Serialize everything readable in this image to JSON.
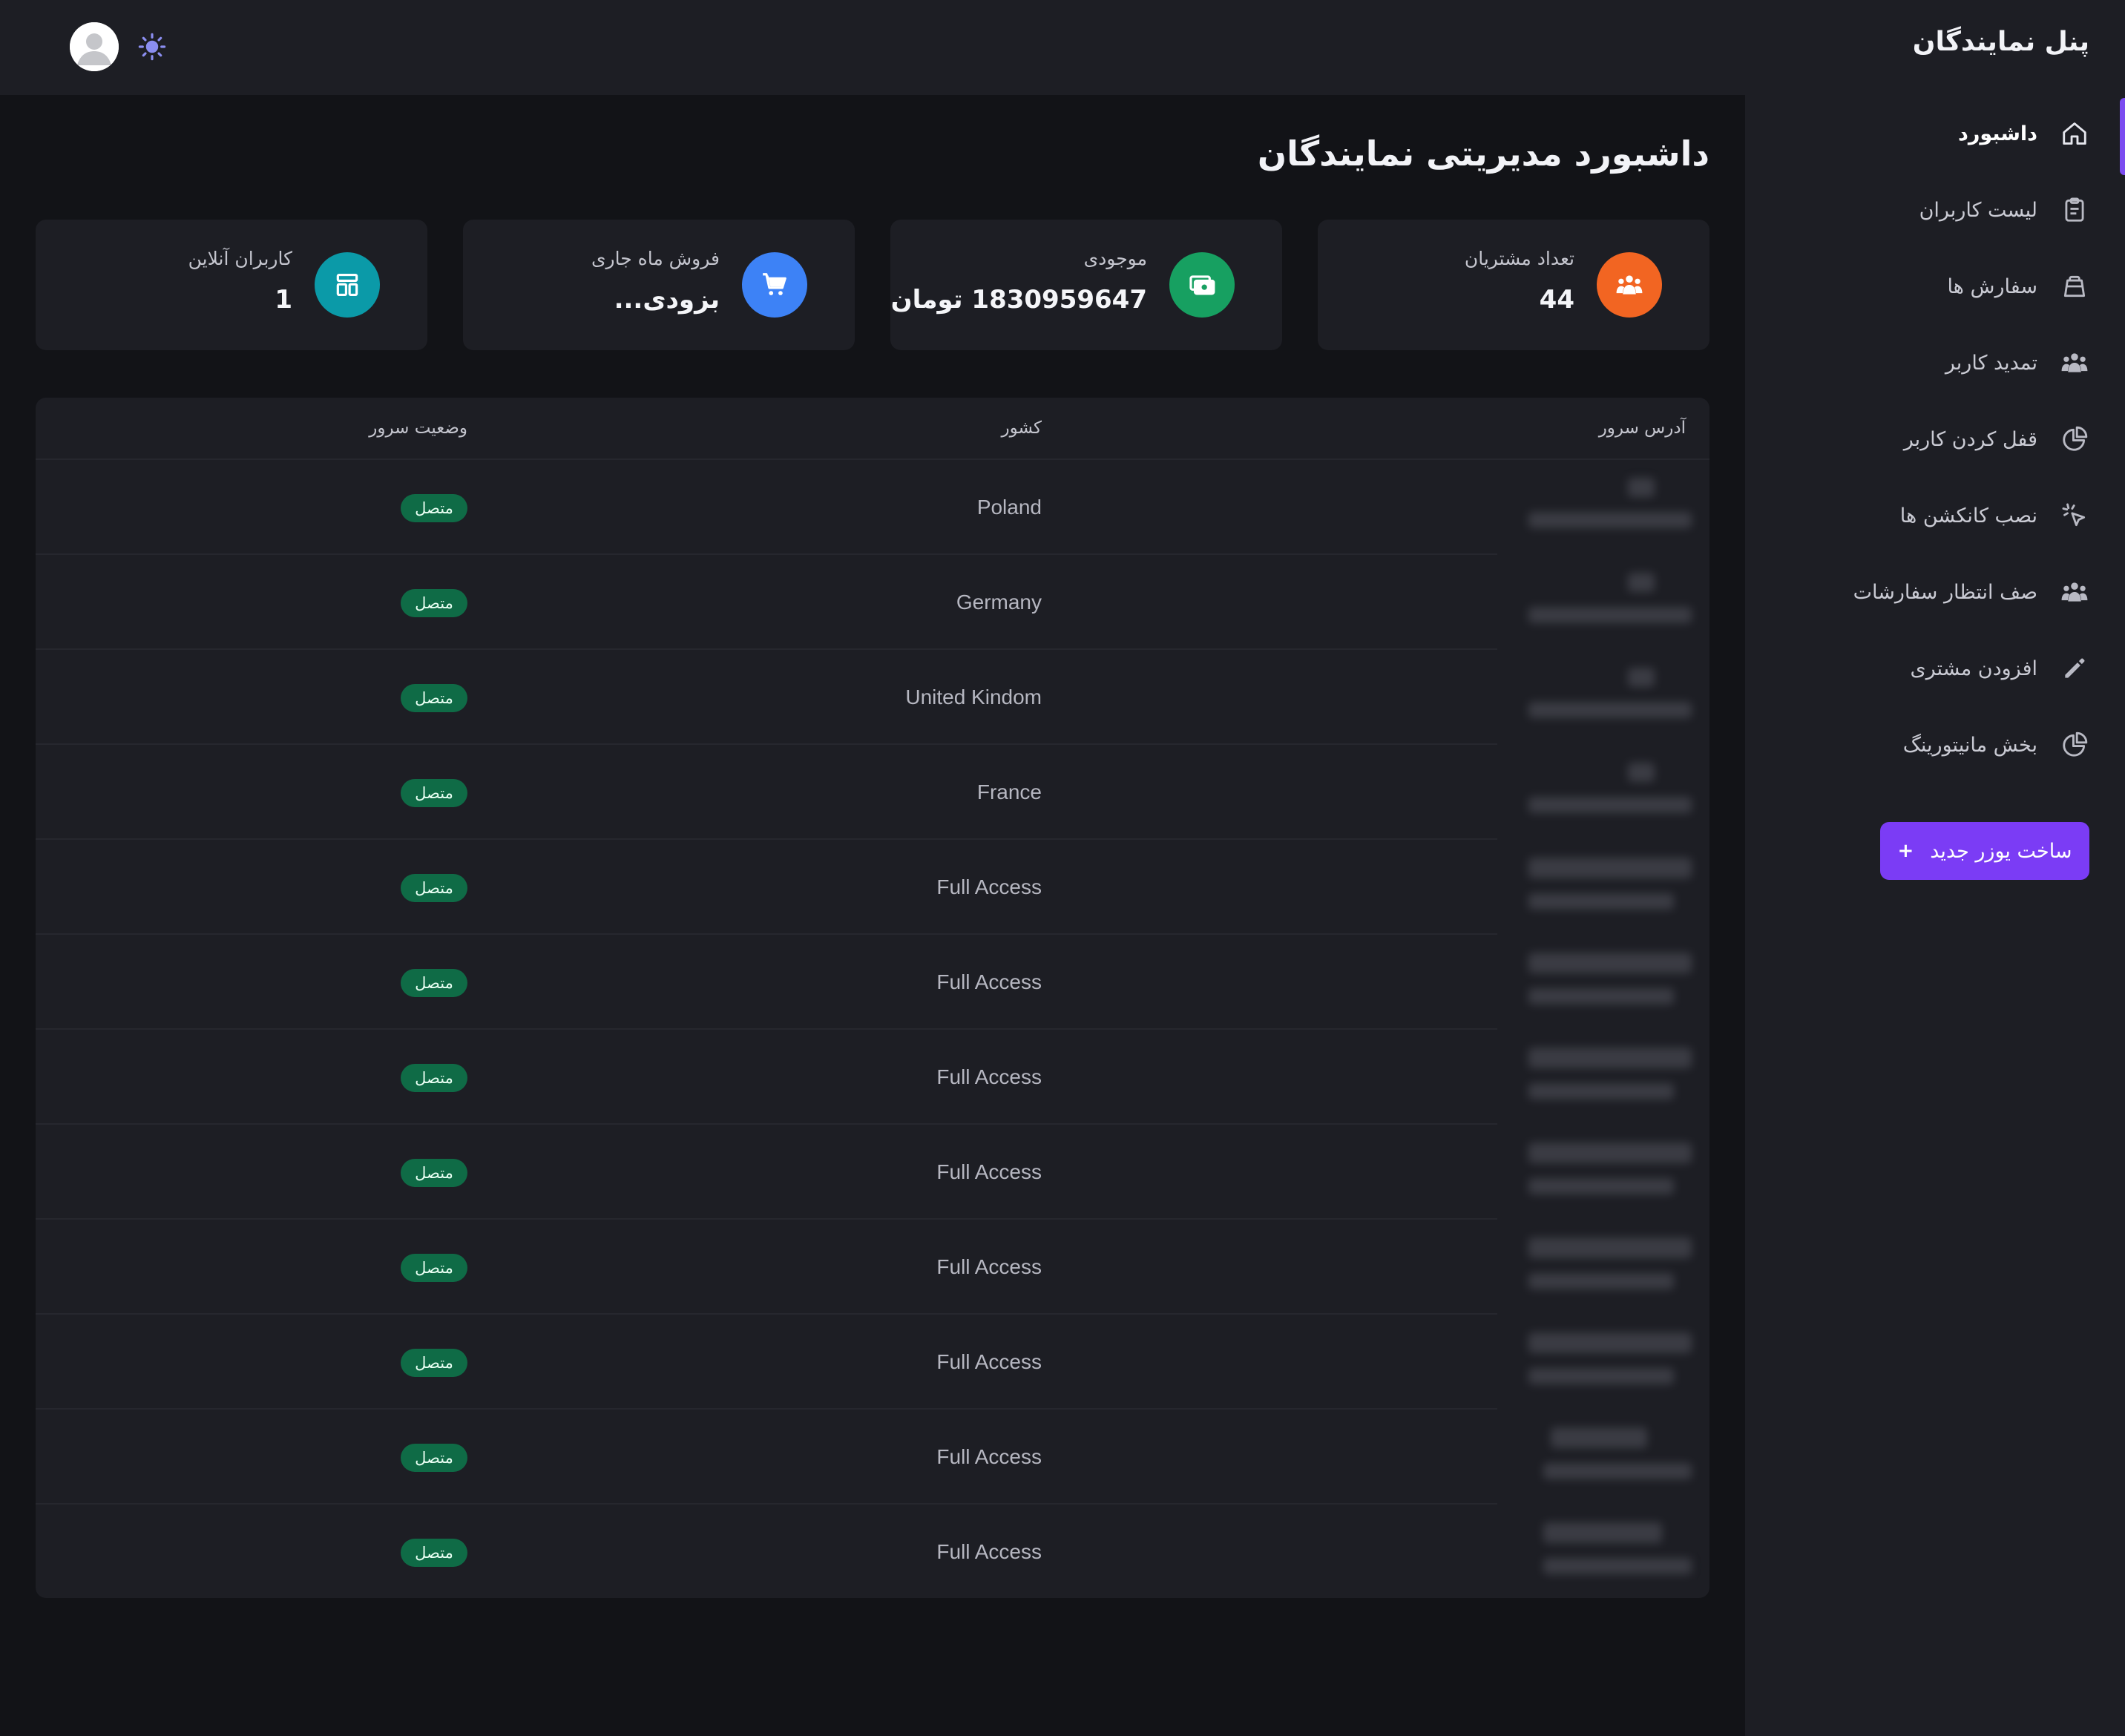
{
  "sidebar": {
    "brand": "پنل نمایندگان",
    "items": [
      {
        "label": "داشبورد",
        "icon": "home-icon",
        "active": true
      },
      {
        "label": "لیست کاربران",
        "icon": "clipboard-icon",
        "active": false
      },
      {
        "label": "سفارش ها",
        "icon": "bag-icon",
        "active": false
      },
      {
        "label": "تمدید کاربر",
        "icon": "users-icon",
        "active": false
      },
      {
        "label": "قفل کردن کاربر",
        "icon": "pie-chart-icon",
        "active": false
      },
      {
        "label": "نصب کانکشن ها",
        "icon": "pointer-click-icon",
        "active": false
      },
      {
        "label": "صف انتظار سفارشات",
        "icon": "users-icon",
        "active": false
      },
      {
        "label": "افزودن مشتری",
        "icon": "pencil-icon",
        "active": false
      },
      {
        "label": "بخش مانیتورینگ",
        "icon": "pie-chart-icon",
        "active": false
      }
    ],
    "create_button": {
      "label": "ساخت یوزر جدید",
      "plus": "+"
    }
  },
  "topbar": {
    "avatar_icon": "user-avatar-icon",
    "theme_icon": "sun-icon"
  },
  "main": {
    "title": "داشبورد مدیریتی نمایندگان",
    "stats": [
      {
        "label": "تعداد مشتریان",
        "value": "44",
        "icon": "users-group-icon",
        "color": "#f26522"
      },
      {
        "label": "موجودی",
        "value": "1830959647 تومان",
        "icon": "money-icon",
        "color": "#17a061"
      },
      {
        "label": "فروش ماه جاری",
        "value": "بزودی...",
        "icon": "cart-icon",
        "color": "#3d82f6"
      },
      {
        "label": "کاربران آنلاین",
        "value": "1",
        "icon": "layout-icon",
        "color": "#0b9aa8"
      }
    ],
    "table": {
      "headers": {
        "address": "آدرس سرور",
        "country": "کشور",
        "status": "وضعیت سرور"
      },
      "rows": [
        {
          "country": "Poland",
          "status": "متصل"
        },
        {
          "country": "Germany",
          "status": "متصل"
        },
        {
          "country": "United Kindom",
          "status": "متصل"
        },
        {
          "country": "France",
          "status": "متصل"
        },
        {
          "country": "Full Access",
          "status": "متصل"
        },
        {
          "country": "Full Access",
          "status": "متصل"
        },
        {
          "country": "Full Access",
          "status": "متصل"
        },
        {
          "country": "Full Access",
          "status": "متصل"
        },
        {
          "country": "Full Access",
          "status": "متصل"
        },
        {
          "country": "Full Access",
          "status": "متصل"
        },
        {
          "country": "Full Access",
          "status": "متصل"
        },
        {
          "country": "Full Access",
          "status": "متصل"
        }
      ]
    }
  },
  "colors": {
    "accent": "#7b3cf5",
    "status_ok": "#0f6b46",
    "background": "#121317",
    "panel": "#1d1e24"
  }
}
